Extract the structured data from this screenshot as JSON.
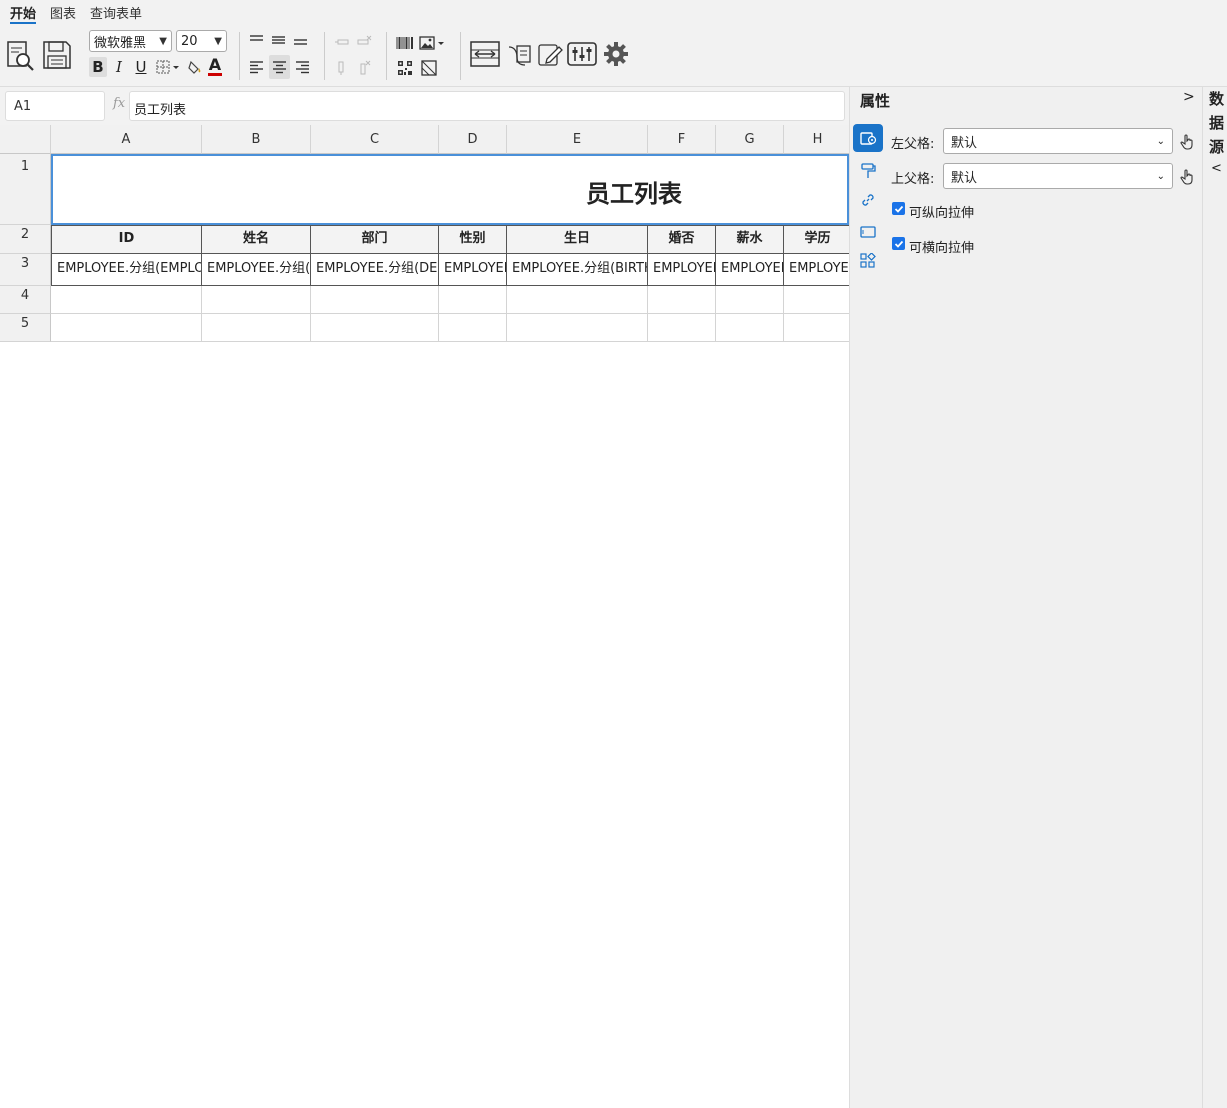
{
  "tabs": [
    {
      "label": "开始",
      "active": true
    },
    {
      "label": "图表",
      "active": false
    },
    {
      "label": "查询表单",
      "active": false
    }
  ],
  "toolbar": {
    "font_family": "微软雅黑",
    "font_size": "20",
    "bold_label": "B",
    "italic_label": "I",
    "underline_label": "U",
    "font_color_label": "A",
    "font_color": "#cc0000",
    "accent_color": "#1a73c8"
  },
  "formula": {
    "cell_ref": "A1",
    "fx_label": "fx",
    "value": "员工列表"
  },
  "grid": {
    "columns": [
      "A",
      "B",
      "C",
      "D",
      "E",
      "F",
      "G",
      "H"
    ],
    "rows": [
      "1",
      "2",
      "3",
      "4",
      "5"
    ],
    "title": "员工列表",
    "headers": [
      "ID",
      "姓名",
      "部门",
      "性别",
      "生日",
      "婚否",
      "薪水",
      "学历"
    ],
    "data_row": [
      "EMPLOYEE.分组(EMPLOYEE_ID)",
      "EMPLOYEE.分组(NAME)",
      "EMPLOYEE.分组(DEPT)",
      "EMPLOYEE.分组(SEX)",
      "EMPLOYEE.分组(BIRTHDAY)",
      "EMPLOYEE.分组(MARRY)",
      "EMPLOYEE.分组(SALARY)",
      "EMPLOYEE.分组(EDU)"
    ]
  },
  "panel": {
    "title": "属性",
    "collapse": ">",
    "left_parent_label": "左父格:",
    "left_parent_value": "默认",
    "top_parent_label": "上父格:",
    "top_parent_value": "默认",
    "vertical_stretch_label": "可纵向拉伸",
    "vertical_stretch_checked": true,
    "horizontal_stretch_label": "可横向拉伸",
    "horizontal_stretch_checked": true
  },
  "datasource": {
    "label": "数据源",
    "expand": "<"
  }
}
